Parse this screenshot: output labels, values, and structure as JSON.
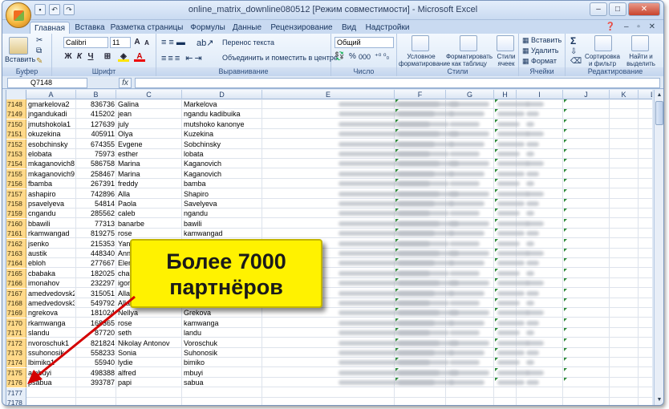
{
  "window": {
    "title": "online_matrix_downline080512  [Режим совместимости] - Microsoft Excel"
  },
  "tabs": [
    "Главная",
    "Вставка",
    "Разметка страницы",
    "Формулы",
    "Данные",
    "Рецензирование",
    "Вид",
    "Надстройки"
  ],
  "ribbon": {
    "clipboard": {
      "paste_label": "Вставить",
      "group_label": "Буфер обмена"
    },
    "font": {
      "font_name": "Calibri",
      "font_size": "11",
      "bold": "Ж",
      "italic": "К",
      "underline": "Ч",
      "group_label": "Шрифт"
    },
    "alignment": {
      "wrap_text": "Перенос текста",
      "merge_center": "Объединить и поместить в центре",
      "group_label": "Выравнивание"
    },
    "number": {
      "format": "Общий",
      "percent": "%",
      "thousands": "000",
      "group_label": "Число"
    },
    "styles": {
      "conditional": "Условное форматирование",
      "as_table": "Форматировать как таблицу",
      "cell_styles": "Стили ячеек",
      "group_label": "Стили"
    },
    "cells": {
      "insert": "Вставить",
      "delete": "Удалить",
      "format": "Формат",
      "group_label": "Ячейки"
    },
    "editing": {
      "sum": "Σ",
      "sort": "Сортировка и фильтр",
      "find": "Найти и выделить",
      "group_label": "Редактирование"
    }
  },
  "formula_bar": {
    "name_box": "Q7148",
    "fx": "fx",
    "value": ""
  },
  "columns": [
    "A",
    "B",
    "C",
    "D",
    "E",
    "F",
    "G",
    "H",
    "I",
    "J",
    "K",
    "L",
    "M"
  ],
  "rows": [
    {
      "num": "7148",
      "a": "gmarkelova2",
      "b": "836736",
      "c": "Galina",
      "d": "Markelova"
    },
    {
      "num": "7149",
      "a": "jngandukadi",
      "b": "415202",
      "c": "jean",
      "d": "ngandu kadibuika"
    },
    {
      "num": "7150",
      "a": "jmutshokola1",
      "b": "127639",
      "c": "july",
      "d": "mutshoko kanonye"
    },
    {
      "num": "7151",
      "a": "okuzekina",
      "b": "405911",
      "c": "Olya",
      "d": "Kuzekina"
    },
    {
      "num": "7152",
      "a": "esobchinsky",
      "b": "674355",
      "c": "Evgene",
      "d": "Sobchinsky"
    },
    {
      "num": "7153",
      "a": "elobata",
      "b": "75973",
      "c": "esther",
      "d": "lobata"
    },
    {
      "num": "7154",
      "a": "mkaganovich8",
      "b": "586758",
      "c": "Marina",
      "d": "Kaganovich"
    },
    {
      "num": "7155",
      "a": "mkaganovich9",
      "b": "258467",
      "c": "Marina",
      "d": "Kaganovich"
    },
    {
      "num": "7156",
      "a": "fbamba",
      "b": "267391",
      "c": "freddy",
      "d": "bamba"
    },
    {
      "num": "7157",
      "a": "ashapiro",
      "b": "742896",
      "c": "Alla",
      "d": "Shapiro"
    },
    {
      "num": "7158",
      "a": "psavelyeva",
      "b": "54814",
      "c": "Paola",
      "d": "Savelyeva"
    },
    {
      "num": "7159",
      "a": "cngandu",
      "b": "285562",
      "c": "caleb",
      "d": "ngandu"
    },
    {
      "num": "7160",
      "a": "bbawili",
      "b": "77313",
      "c": "banarbe",
      "d": "bawili"
    },
    {
      "num": "7161",
      "a": "rkamwangad",
      "b": "819275",
      "c": "rose",
      "d": "kamwangad"
    },
    {
      "num": "7162",
      "a": "jsenko",
      "b": "215353",
      "c": "Yana",
      "d": "Senko"
    },
    {
      "num": "7163",
      "a": "austik",
      "b": "448340",
      "c": "Anna",
      "d": ""
    },
    {
      "num": "7164",
      "a": "ebloh",
      "b": "277667",
      "c": "Elena",
      "d": ""
    },
    {
      "num": "7165",
      "a": "cbabaka",
      "b": "182025",
      "c": "chantal",
      "d": ""
    },
    {
      "num": "7166",
      "a": "imonahov",
      "b": "232297",
      "c": "igor",
      "d": ""
    },
    {
      "num": "7167",
      "a": "amedvedovsk2",
      "b": "315051",
      "c": "Alla",
      "d": ""
    },
    {
      "num": "7168",
      "a": "amedvedovsk3",
      "b": "549792",
      "c": "Alla",
      "d": ""
    },
    {
      "num": "7169",
      "a": "ngrekova",
      "b": "181024",
      "c": "Nellya",
      "d": "Grekova"
    },
    {
      "num": "7170",
      "a": "rkamwanga",
      "b": "168365",
      "c": "rose",
      "d": "kamwanga"
    },
    {
      "num": "7171",
      "a": "slandu",
      "b": "87720",
      "c": "seth",
      "d": "landu"
    },
    {
      "num": "7172",
      "a": "nvoroschuk1",
      "b": "821824",
      "c": "Nikolay Antonov",
      "d": "Voroschuk"
    },
    {
      "num": "7173",
      "a": "ssuhonosik",
      "b": "558233",
      "c": "Sonia",
      "d": "Suhonosik"
    },
    {
      "num": "7174",
      "a": "lbimiko1",
      "b": "55940",
      "c": "lydie",
      "d": "bimiko"
    },
    {
      "num": "7175",
      "a": "ambuyi",
      "b": "498388",
      "c": "alfred",
      "d": "mbuyi"
    },
    {
      "num": "7176",
      "a": "psabua",
      "b": "393787",
      "c": "papi",
      "d": "sabua"
    },
    {
      "num": "7177",
      "a": "",
      "b": "",
      "c": "",
      "d": ""
    },
    {
      "num": "7178",
      "a": "",
      "b": "",
      "c": "",
      "d": ""
    }
  ],
  "callout": {
    "line1": "Более 7000",
    "line2": "партнёров"
  },
  "colors": {
    "callout_bg": "#fff200",
    "arrow": "#d40000",
    "row_header_highlight": "#ffd98a"
  }
}
